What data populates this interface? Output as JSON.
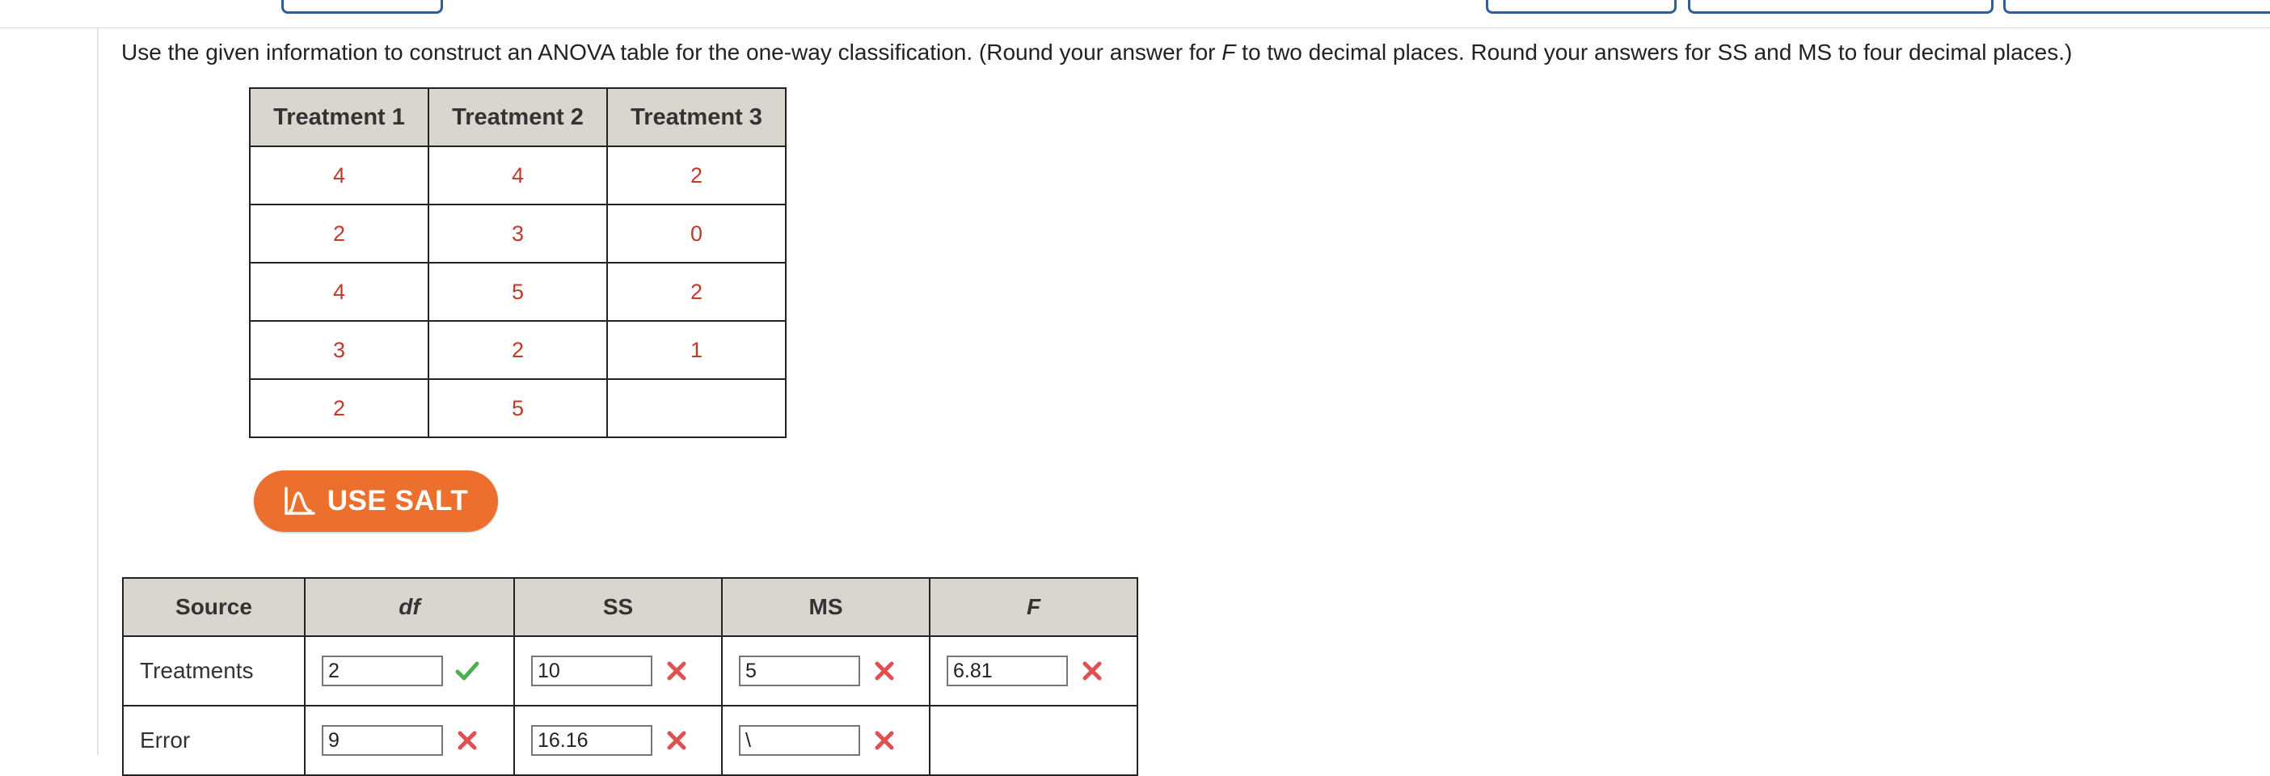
{
  "prompt": {
    "before_f": "Use the given information to construct an ANOVA table for the one-way classification. (Round your answer for ",
    "f_symbol": "F",
    "after_f": " to two decimal places. Round your answers for SS and MS to four decimal places.)"
  },
  "data_table": {
    "headers": [
      "Treatment 1",
      "Treatment 2",
      "Treatment 3"
    ],
    "rows": [
      [
        "4",
        "4",
        "2"
      ],
      [
        "2",
        "3",
        "0"
      ],
      [
        "4",
        "5",
        "2"
      ],
      [
        "3",
        "2",
        "1"
      ],
      [
        "2",
        "5",
        ""
      ]
    ]
  },
  "salt_button": {
    "label": "USE SALT"
  },
  "anova": {
    "headers": {
      "source": "Source",
      "df": "df",
      "ss": "SS",
      "ms": "MS",
      "f": "F"
    },
    "rows": [
      {
        "source": "Treatments",
        "df": {
          "value": "2",
          "status": "correct"
        },
        "ss": {
          "value": "10",
          "status": "incorrect"
        },
        "ms": {
          "value": "5",
          "status": "incorrect"
        },
        "f": {
          "value": "6.81",
          "status": "incorrect"
        }
      },
      {
        "source": "Error",
        "df": {
          "value": "9",
          "status": "incorrect"
        },
        "ss": {
          "value": "16.16",
          "status": "incorrect"
        },
        "ms": {
          "value": "\\",
          "status": "incorrect"
        }
      }
    ]
  },
  "colors": {
    "data_value": "#c0392b",
    "header_bg": "#d9d5cf",
    "salt_orange": "#ec6f2d",
    "check_green": "#4caf50",
    "cross_red": "#e05050",
    "top_button_blue": "#2f5f95"
  },
  "icons": {
    "correct": "checkmark-icon",
    "incorrect": "cross-icon",
    "salt": "salt-logo-icon"
  }
}
